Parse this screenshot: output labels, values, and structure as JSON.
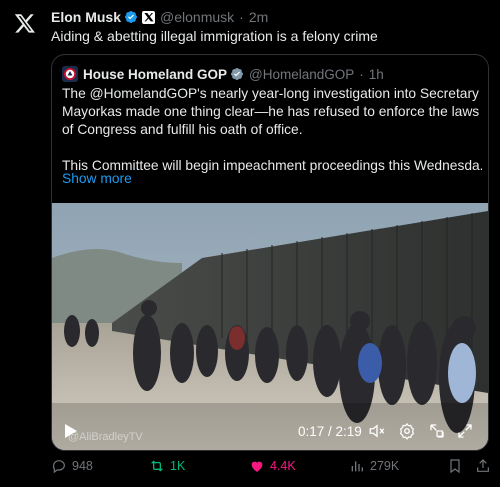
{
  "tweet": {
    "author_name": "Elon Musk",
    "author_handle": "@elonmusk",
    "separator": "·",
    "time": "2m",
    "text": "Aiding & abetting illegal immigration is a felony crime"
  },
  "quote": {
    "author_name": "House Homeland GOP",
    "author_handle": "@HomelandGOP",
    "separator": "·",
    "time": "1h",
    "paragraph1": "The @HomelandGOP's nearly year-long investigation into Secretary Mayorkas made one thing clear—he has refused to enforce the laws of Congress and fulfill his oath of office.",
    "paragraph2": "This Committee will begin impeachment proceedings this Wednesda...",
    "show_more": "Show more",
    "video": {
      "watermark": "@AliBradleyTV",
      "time": "0:17 / 2:19"
    }
  },
  "actions": {
    "replies": "948",
    "reposts": "1K",
    "likes": "4.4K",
    "views": "279K"
  },
  "colors": {
    "accent_blue": "#1d9bf0",
    "repost_green": "#00ba7c",
    "like_pink": "#f91880",
    "muted_text": "#71767b"
  }
}
